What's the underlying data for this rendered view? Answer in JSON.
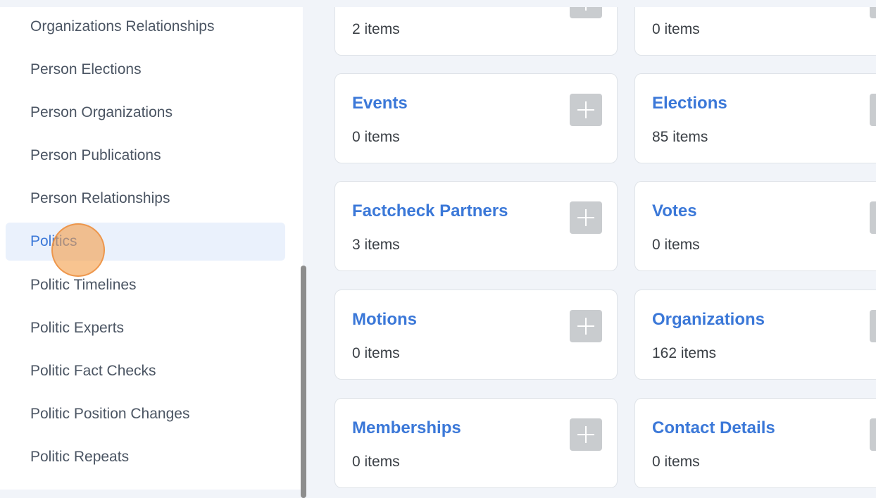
{
  "sidebar": {
    "items": [
      {
        "label": "Organizations Relationships"
      },
      {
        "label": "Person Elections"
      },
      {
        "label": "Person Organizations"
      },
      {
        "label": "Person Publications"
      },
      {
        "label": "Person Relationships"
      },
      {
        "label": "Politics",
        "active": true
      },
      {
        "label": "Politic Timelines"
      },
      {
        "label": "Politic Experts"
      },
      {
        "label": "Politic Fact Checks"
      },
      {
        "label": "Politic Position Changes"
      },
      {
        "label": "Politic Repeats"
      }
    ]
  },
  "cards": [
    {
      "title": "",
      "count": "2 items"
    },
    {
      "title": "",
      "count": "0 items"
    },
    {
      "title": "Events",
      "count": "0 items"
    },
    {
      "title": "Elections",
      "count": "85 items"
    },
    {
      "title": "Factcheck Partners",
      "count": "3 items"
    },
    {
      "title": "Votes",
      "count": "0 items"
    },
    {
      "title": "Motions",
      "count": "0 items"
    },
    {
      "title": "Organizations",
      "count": "162 items"
    },
    {
      "title": "Memberships",
      "count": "0 items"
    },
    {
      "title": "Contact Details",
      "count": "0 items"
    }
  ],
  "add_icon": "plus-icon",
  "colors": {
    "accent": "#3b78d8",
    "active_bg": "#eaf1fc",
    "add_button": "#c9cccf",
    "cursor_highlight": "#f4a049"
  }
}
